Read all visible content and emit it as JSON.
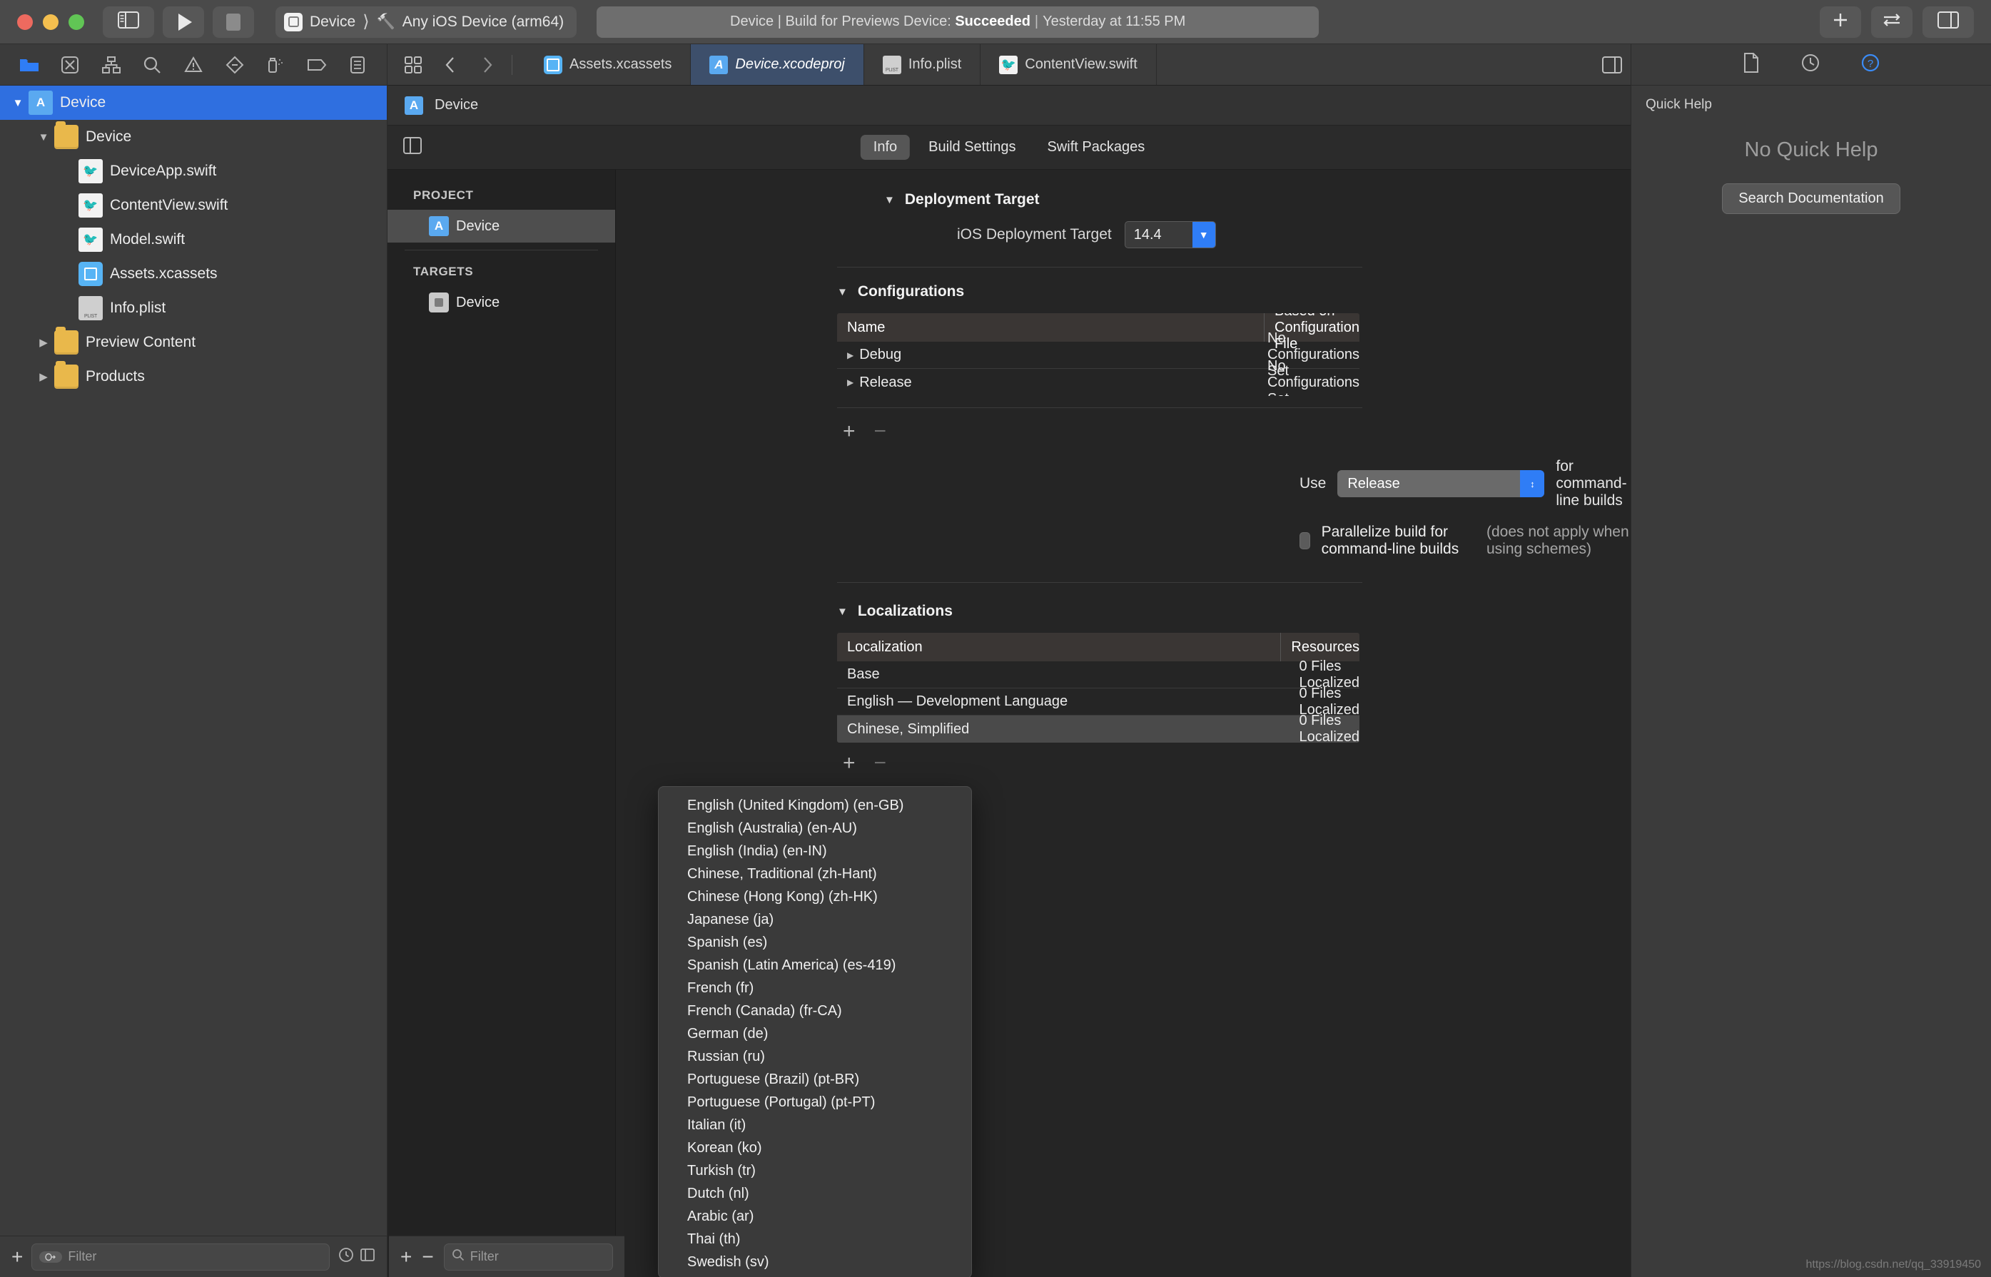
{
  "window": {
    "traffic_lights": [
      "close",
      "minimize",
      "zoom"
    ]
  },
  "toolbar": {
    "scheme_name": "Device",
    "destination": "Any iOS Device (arm64)",
    "status_prefix": "Device | Build for Previews Device:",
    "status_result": "Succeeded",
    "status_time": "Yesterday at 11:55 PM",
    "status_sep": "|",
    "run_button": "run",
    "stop_button": "stop",
    "add_button": "+",
    "icons": {
      "sidebar_toggle": "sidebar-toggle-icon",
      "play": "play-icon",
      "stop": "stop-icon",
      "hammer": "hammer-icon",
      "plus": "plus-icon",
      "swap": "swap-icon",
      "inspector_toggle": "inspector-toggle-icon"
    }
  },
  "navigator": {
    "tabs": [
      {
        "name": "project-navigator",
        "icon": "folder-icon",
        "active": true
      },
      {
        "name": "source-control-navigator",
        "icon": "source-control-icon",
        "active": false
      },
      {
        "name": "symbol-navigator",
        "icon": "hierarchy-icon",
        "active": false
      },
      {
        "name": "find-navigator",
        "icon": "search-icon",
        "active": false
      },
      {
        "name": "issue-navigator",
        "icon": "warning-icon",
        "active": false
      },
      {
        "name": "test-navigator",
        "icon": "diamond-icon",
        "active": false
      },
      {
        "name": "debug-navigator",
        "icon": "spray-icon",
        "active": false
      },
      {
        "name": "breakpoint-navigator",
        "icon": "tag-icon",
        "active": false
      },
      {
        "name": "report-navigator",
        "icon": "report-icon",
        "active": false
      }
    ],
    "tree": [
      {
        "label": "Device",
        "icon": "project-icon",
        "indent": 0,
        "disclosure": "open",
        "selected": true
      },
      {
        "label": "Device",
        "icon": "folder-icon",
        "indent": 1,
        "disclosure": "open",
        "selected": false
      },
      {
        "label": "DeviceApp.swift",
        "icon": "swift-icon",
        "indent": 2,
        "disclosure": "none",
        "selected": false
      },
      {
        "label": "ContentView.swift",
        "icon": "swift-icon",
        "indent": 2,
        "disclosure": "none",
        "selected": false
      },
      {
        "label": "Model.swift",
        "icon": "swift-icon",
        "indent": 2,
        "disclosure": "none",
        "selected": false
      },
      {
        "label": "Assets.xcassets",
        "icon": "xcassets-icon",
        "indent": 2,
        "disclosure": "none",
        "selected": false
      },
      {
        "label": "Info.plist",
        "icon": "plist-icon",
        "indent": 2,
        "disclosure": "none",
        "selected": false
      },
      {
        "label": "Preview Content",
        "icon": "folder-icon",
        "indent": 1,
        "disclosure": "closed",
        "selected": false
      },
      {
        "label": "Products",
        "icon": "folder-icon",
        "indent": 1,
        "disclosure": "closed",
        "selected": false
      }
    ],
    "filter_placeholder": "Filter",
    "add_label": "+"
  },
  "editor": {
    "tabs": [
      {
        "label": "Assets.xcassets",
        "icon": "xcassets-icon",
        "active": false
      },
      {
        "label": "Device.xcodeproj",
        "icon": "project-icon",
        "active": true
      },
      {
        "label": "Info.plist",
        "icon": "plist-icon",
        "active": false
      },
      {
        "label": "ContentView.swift",
        "icon": "swift-icon",
        "active": false
      }
    ],
    "jumpbar": {
      "label": "Device",
      "icon": "project-icon"
    },
    "segments": [
      {
        "label": "Info",
        "active": true
      },
      {
        "label": "Build Settings",
        "active": false
      },
      {
        "label": "Swift Packages",
        "active": false
      }
    ]
  },
  "project_list": {
    "project_header": "PROJECT",
    "project_items": [
      {
        "label": "Device",
        "selected": true
      }
    ],
    "targets_header": "TARGETS",
    "target_items": [
      {
        "label": "Device",
        "selected": false
      }
    ]
  },
  "detail": {
    "deployment": {
      "section_title": "Deployment Target",
      "field_label": "iOS Deployment Target",
      "value": "14.4"
    },
    "configurations": {
      "section_title": "Configurations",
      "columns": [
        "Name",
        "Based on Configuration File"
      ],
      "rows": [
        {
          "name": "Debug",
          "based_on": "No Configurations Set"
        },
        {
          "name": "Release",
          "based_on": "No Configurations Set"
        }
      ],
      "add_label": "+",
      "remove_label": "−",
      "use_prefix": "Use",
      "use_value": "Release",
      "use_suffix": "for command-line builds",
      "parallelize_label": "Parallelize build for command-line builds",
      "parallelize_note": "(does not apply when using schemes)",
      "parallelize_checked": false
    },
    "localizations": {
      "section_title": "Localizations",
      "columns": [
        "Localization",
        "Resources"
      ],
      "rows": [
        {
          "name": "Base",
          "resources": "0 Files Localized",
          "selected": false
        },
        {
          "name": "English — Development Language",
          "resources": "0 Files Localized",
          "selected": false
        },
        {
          "name": "Chinese, Simplified",
          "resources": "0 Files Localized",
          "selected": true
        }
      ],
      "add_label": "+",
      "remove_label": "−"
    }
  },
  "language_menu": {
    "items": [
      "English (United Kingdom) (en-GB)",
      "English (Australia) (en-AU)",
      "English (India) (en-IN)",
      "Chinese, Traditional (zh-Hant)",
      "Chinese (Hong Kong) (zh-HK)",
      "Japanese (ja)",
      "Spanish (es)",
      "Spanish (Latin America) (es-419)",
      "French (fr)",
      "French (Canada) (fr-CA)",
      "German (de)",
      "Russian (ru)",
      "Portuguese (Brazil) (pt-BR)",
      "Portuguese (Portugal) (pt-PT)",
      "Italian (it)",
      "Korean (ko)",
      "Turkish (tr)",
      "Dutch (nl)",
      "Arabic (ar)",
      "Thai (th)",
      "Swedish (sv)"
    ]
  },
  "inspector": {
    "tabs": [
      {
        "name": "file-inspector",
        "icon": "document-icon",
        "active": false
      },
      {
        "name": "history-inspector",
        "icon": "clock-icon",
        "active": false
      },
      {
        "name": "quick-help-inspector",
        "icon": "help-icon",
        "active": true
      }
    ],
    "title": "Quick Help",
    "empty_message": "No Quick Help",
    "search_button": "Search Documentation"
  },
  "watermark": "https://blog.csdn.net/qq_33919450",
  "colors": {
    "accent_blue": "#2f7df6",
    "selection_blue": "#2f6fe0",
    "tab_active": "#3d4f6b",
    "status_green": "#61c555",
    "status_yellow": "#f4bf4f",
    "status_red": "#ed6a5f"
  }
}
